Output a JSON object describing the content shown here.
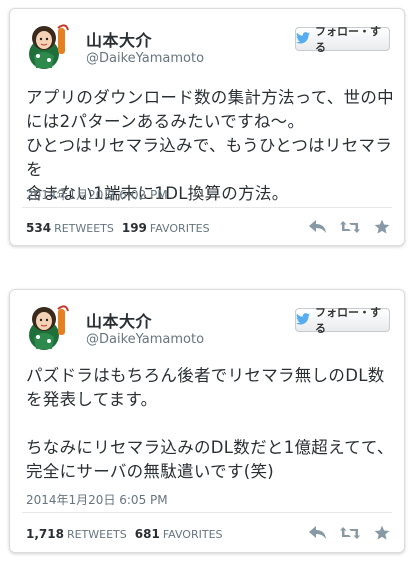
{
  "tweets": [
    {
      "name": "山本大介",
      "handle": "@DaikeYamamoto",
      "follow_label": "フォロー・する",
      "text": "アプリのダウンロード数の集計方法って、世の中\nには2パターンあるみたいですね〜。\nひとつはリセマラ込みで、もうひとつはリセマラを\n含まない1端末に1DL換算の方法。",
      "timestamp": "2014年1月20日 6:02 PM",
      "retweets": "534",
      "retweets_label": "RETWEETS",
      "favorites": "199",
      "favorites_label": "FAVORITES"
    },
    {
      "name": "山本大介",
      "handle": "@DaikeYamamoto",
      "follow_label": "フォロー・する",
      "text": "パズドラはもちろん後者でリセマラ無しのDL数\nを発表してます。\n\nちなみにリセマラ込みのDL数だと1億超えてて、\n完全にサーバの無駄遣いです(笑)",
      "timestamp": "2014年1月20日 6:05 PM",
      "retweets": "1,718",
      "retweets_label": "RETWEETS",
      "favorites": "681",
      "favorites_label": "FAVORITES"
    }
  ],
  "icons": {
    "bird": "twitter-bird-icon",
    "reply": "reply-icon",
    "retweet": "retweet-icon",
    "favorite": "star-icon"
  },
  "colors": {
    "twitter_blue": "#55acee",
    "action_gray": "#8899a6",
    "meta_gray": "#66757f",
    "text": "#292f33"
  }
}
